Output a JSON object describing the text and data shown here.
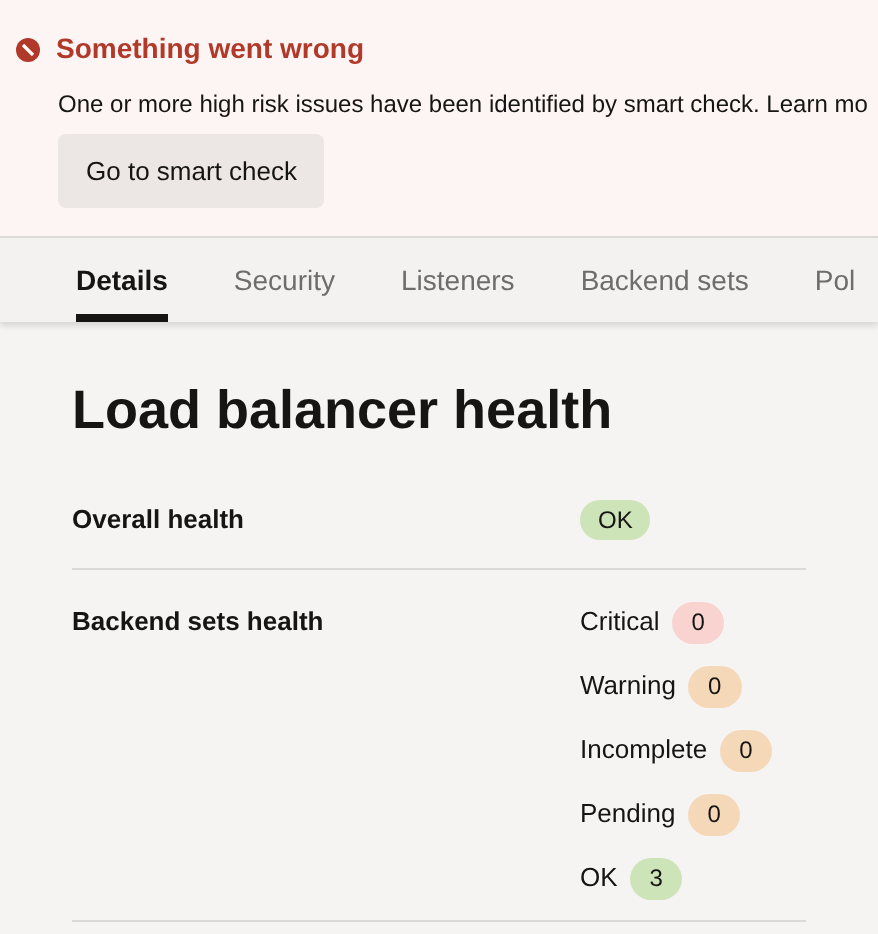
{
  "alert": {
    "title": "Something went wrong",
    "message": "One or more high risk issues have been identified by smart check. Learn mo",
    "button": "Go to smart check"
  },
  "tabs": [
    {
      "label": "Details",
      "selected": true
    },
    {
      "label": "Security",
      "selected": false
    },
    {
      "label": "Listeners",
      "selected": false
    },
    {
      "label": "Backend sets",
      "selected": false
    },
    {
      "label": "Pol",
      "selected": false
    }
  ],
  "heading": "Load balancer health",
  "overall_health": {
    "label": "Overall health",
    "status": {
      "text": "OK",
      "color": "#cde3b8"
    }
  },
  "backend_sets_health": {
    "label": "Backend sets health",
    "items": [
      {
        "label": "Critical",
        "count": "0",
        "color": "#f8d3d0"
      },
      {
        "label": "Warning",
        "count": "0",
        "color": "#f5d8b8"
      },
      {
        "label": "Incomplete",
        "count": "0",
        "color": "#f5d8b8"
      },
      {
        "label": "Pending",
        "count": "0",
        "color": "#f5d8b8"
      },
      {
        "label": "OK",
        "count": "3",
        "color": "#cde3b8"
      }
    ]
  }
}
